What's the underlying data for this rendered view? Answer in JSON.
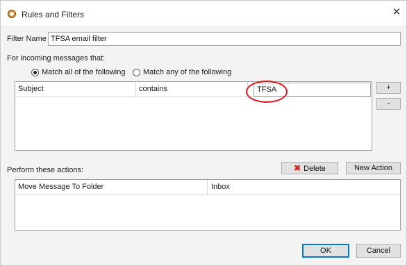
{
  "window": {
    "title": "Rules and Filters",
    "close_glyph": "✕"
  },
  "filter": {
    "label": "Filter Name",
    "value": "TFSA email filter"
  },
  "incoming": {
    "label": "For incoming messages that:",
    "match_all": "Match all of the following",
    "match_any": "Match any of the following",
    "selected": "match_all"
  },
  "conditions": [
    {
      "field": "Subject",
      "operator": "contains",
      "value": "TFSA"
    }
  ],
  "condition_buttons": {
    "add": "+",
    "remove": "-"
  },
  "actions_section": {
    "label": "Perform these actions:",
    "delete_label": "Delete",
    "new_action_label": "New Action"
  },
  "actions": [
    {
      "action": "Move Message To Folder",
      "target": "Inbox"
    }
  ],
  "footer": {
    "ok": "OK",
    "cancel": "Cancel"
  },
  "colors": {
    "highlight": "#d8171f",
    "delete_icon": "#d0271d",
    "primary_border": "#0078d7"
  }
}
